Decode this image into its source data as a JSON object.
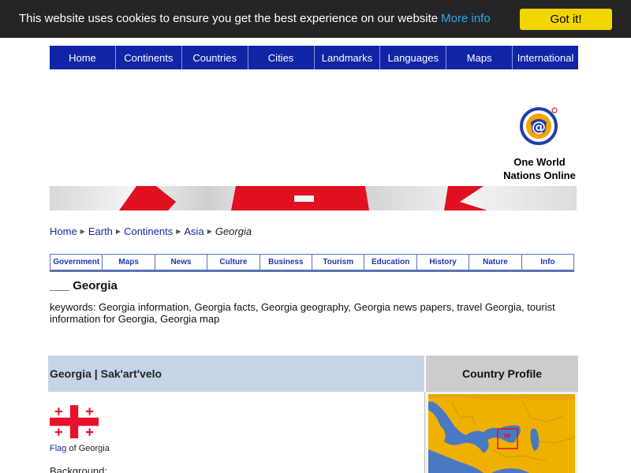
{
  "cookie": {
    "message": "This website uses cookies to ensure you get the best experience on our website",
    "more_info": "More info",
    "accept": "Got it!"
  },
  "nav": {
    "items": [
      "Home",
      "Continents",
      "Countries",
      "Cities",
      "Landmarks",
      "Languages",
      "Maps",
      "International"
    ]
  },
  "logo": {
    "line1": "One World",
    "line2": "Nations Online"
  },
  "breadcrumb": {
    "items": [
      "Home",
      "Earth",
      "Continents",
      "Asia"
    ],
    "current": "Georgia"
  },
  "subnav": {
    "items": [
      "Government",
      "Maps",
      "News",
      "Culture",
      "Business",
      "Tourism",
      "Education",
      "History",
      "Nature",
      "Info"
    ]
  },
  "heading": "___ Georgia",
  "keywords": "keywords: Georgia information, Georgia facts, Georgia geography, Georgia news papers, travel Georgia, tourist information for Georgia, Georgia map",
  "profile": {
    "title": "Georgia | Sak'art'velo",
    "side_title": "Country Profile",
    "flag_link": "Flag",
    "flag_caption_rest": " of Georgia",
    "background_label": "Background:"
  },
  "colors": {
    "cookie_bg": "#252525",
    "cookie_button": "#f1d600",
    "cookie_link": "#31a8f0",
    "nav_bg": "#1025a6",
    "table_header_left": "#c6d4e8",
    "table_header_right": "#cccccc",
    "flag_red": "#e8112d",
    "map_land": "#f0b000",
    "map_water": "#4a79c4"
  }
}
